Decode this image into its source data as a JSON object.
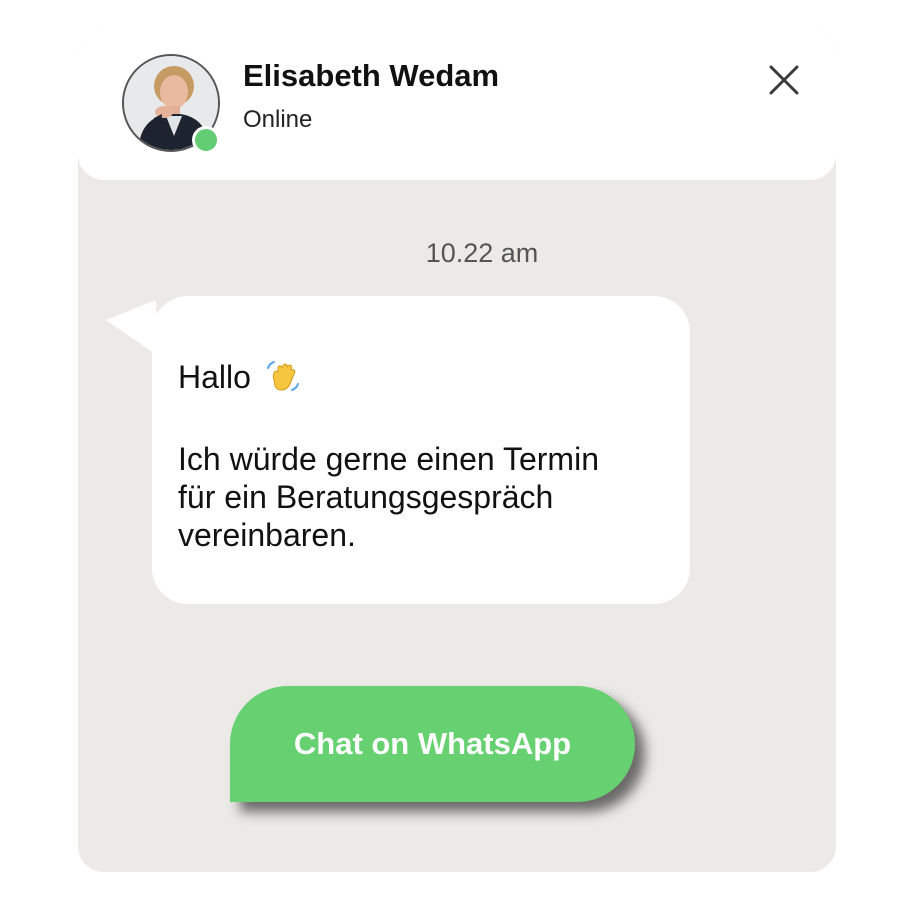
{
  "contact": {
    "name": "Elisabeth Wedam",
    "status": "Online"
  },
  "chat": {
    "timestamp": "10.22 am",
    "message": {
      "greeting": "Hallo",
      "greeting_icon": "waving-hand-icon",
      "lines": [
        "Ich würde gerne einen Termin",
        "für ein Beratungsgespräch",
        "vereinbaren."
      ]
    }
  },
  "cta": {
    "label": "Chat on WhatsApp"
  },
  "colors": {
    "panel_background": "#ebeae7",
    "online_indicator": "#62cd72",
    "cta_button": "#67d071"
  },
  "icons": {
    "close": "close-icon",
    "avatar": "avatar-photo"
  }
}
